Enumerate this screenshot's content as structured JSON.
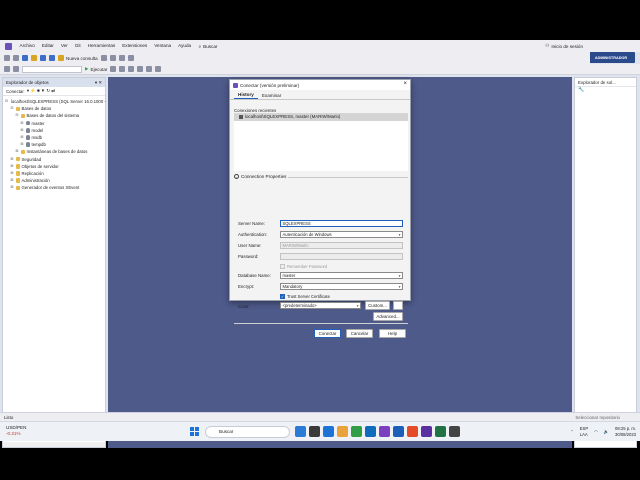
{
  "menubar": {
    "items": [
      "Archivo",
      "Editar",
      "Ver",
      "Git",
      "Herramientas",
      "Extensiones",
      "Ventana",
      "Ayuda"
    ],
    "search_label": "Buscar",
    "login_label": "Inicio de sesión",
    "admin_label": "ADMINISTRADOR"
  },
  "toolbar": {
    "new_query_label": "Nueva consulta",
    "execute_label": "Ejecutar"
  },
  "object_explorer": {
    "title": "Explorador de objetos",
    "connect_label": "Conectar",
    "tree": [
      {
        "level": 0,
        "expander": "⊟",
        "icon": "server",
        "label": "localhost\\SQLEXPRESS (SQL Server 16.0.1000 -"
      },
      {
        "level": 1,
        "expander": "⊟",
        "icon": "folder",
        "label": "Bases de datos"
      },
      {
        "level": 2,
        "expander": "⊟",
        "icon": "folder",
        "label": "Bases de datos del sistema"
      },
      {
        "level": 3,
        "expander": "⊞",
        "icon": "db",
        "label": "master"
      },
      {
        "level": 3,
        "expander": "⊞",
        "icon": "db",
        "label": "model"
      },
      {
        "level": 3,
        "expander": "⊞",
        "icon": "db",
        "label": "msdb"
      },
      {
        "level": 3,
        "expander": "⊞",
        "icon": "db",
        "label": "tempdb"
      },
      {
        "level": 2,
        "expander": "⊞",
        "icon": "folder",
        "label": "Instantáneas de bases de datos"
      },
      {
        "level": 1,
        "expander": "⊞",
        "icon": "folder",
        "label": "Seguridad"
      },
      {
        "level": 1,
        "expander": "⊞",
        "icon": "folder",
        "label": "Objetos de servidor"
      },
      {
        "level": 1,
        "expander": "⊞",
        "icon": "folder",
        "label": "Replicación"
      },
      {
        "level": 1,
        "expander": "⊞",
        "icon": "folder",
        "label": "Administración"
      },
      {
        "level": 1,
        "expander": "⊞",
        "icon": "folder",
        "label": "Generador de eventos XEvent"
      }
    ]
  },
  "right_panel": {
    "title": "Explorador de sol..."
  },
  "dialog": {
    "title": "Conectar (versión preliminar)",
    "tabs": [
      "History",
      "Examinar"
    ],
    "recent_label": "Conexiones recientes",
    "recent_item": "localhost\\SQLEXPRESS, master (MARIW\\Marlo)",
    "section_label": "Connection Properties",
    "server_name_label": "Server Name:",
    "server_name_value": "SQLEXPRESS",
    "auth_label": "Authentication:",
    "auth_value": "Autenticación de Windows",
    "user_label": "User Name:",
    "user_value": "MARIW\\Marlo",
    "password_label": "Password:",
    "password_value": "",
    "remember_label": "Remember Password",
    "db_label": "Database Name:",
    "db_value": "master",
    "encrypt_label": "Encrypt:",
    "encrypt_value": "Mandatory",
    "trust_label": "Trust Server Certificate",
    "color_label": "Color:",
    "color_value": "<predeterminado>",
    "custom_label": "Custom...",
    "advanced_label": "Advanced...",
    "connect_label": "Conectar",
    "cancel_label": "Cancelar",
    "help_label": "Help"
  },
  "statusbar": {
    "left": "Listo",
    "right": "Seleccionar repositorio"
  },
  "taskbar": {
    "weather_name": "USD/PEN",
    "weather_value": "-0.21%",
    "search_placeholder": "Buscar",
    "lang_top": "ESP",
    "lang_bottom": "LAA",
    "time": "08:25 p. m.",
    "date": "30/08/2023",
    "icon_colors": [
      "#2b7bd6",
      "#3a3a3a",
      "#1e73d6",
      "#e8a33b",
      "#2f9e44",
      "#0f6cbd",
      "#7b3fc0",
      "#1b5fb8",
      "#e34c26",
      "#5a2fa0",
      "#217346",
      "#444"
    ]
  },
  "colors": {
    "main_bg": "#4e5a8a",
    "accent": "#1f5fbf",
    "admin_badge": "#2b4a8c"
  }
}
